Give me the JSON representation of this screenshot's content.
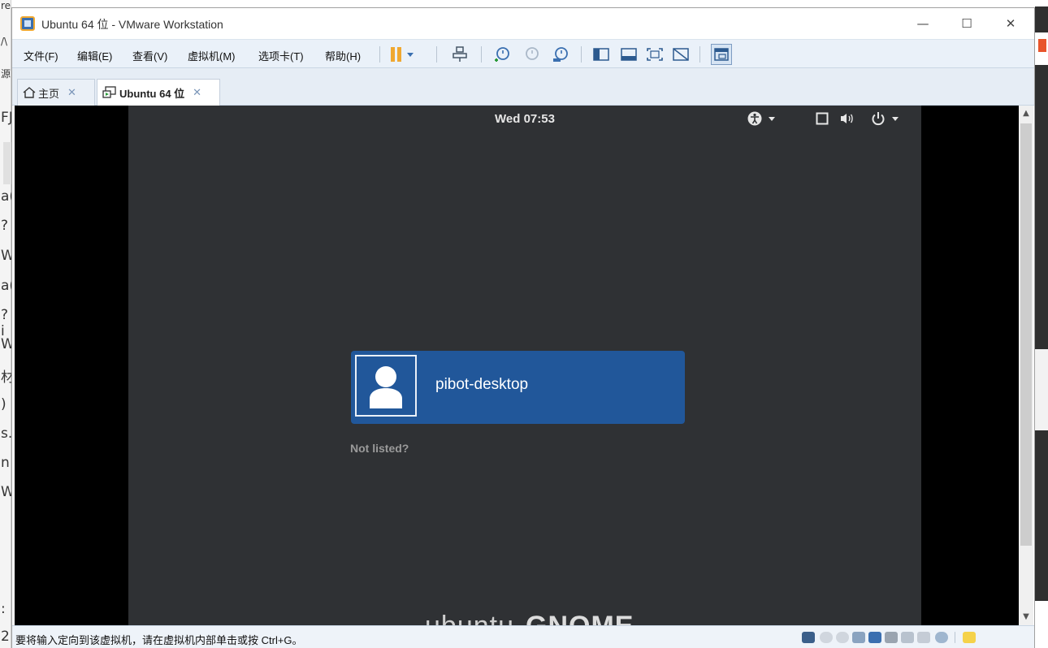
{
  "window": {
    "title": "Ubuntu 64 位 - VMware Workstation",
    "minimize": "—",
    "maximize": "☐",
    "close": "✕"
  },
  "menu": {
    "file": "文件(F)",
    "edit": "编辑(E)",
    "view": "查看(V)",
    "vm": "虚拟机(M)",
    "tabs": "选项卡(T)",
    "help": "帮助(H)"
  },
  "tabs": [
    {
      "label": "主页",
      "close": "✕"
    },
    {
      "label": "Ubuntu 64 位",
      "close": "✕"
    }
  ],
  "vm_screen": {
    "clock": "Wed 07:53",
    "user_name": "pibot-desktop",
    "not_listed": "Not listed?",
    "footer_logo_left": "ubuntu",
    "footer_logo_right": "GNOME"
  },
  "status": {
    "message": "要将输入定向到该虚拟机，请在虚拟机内部单击或按 Ctrl+G。"
  },
  "left_fragments": [
    "re",
    "/\\",
    "源",
    "FJ",
    "a(",
    "?",
    "W",
    "a(",
    "?i",
    "W",
    "材",
    ")",
    "s.",
    "n",
    "W",
    ":",
    "2"
  ],
  "colors": {
    "accent_blue": "#21579a",
    "gnome_bg": "#2f3134",
    "pause_orange": "#f0a830"
  }
}
